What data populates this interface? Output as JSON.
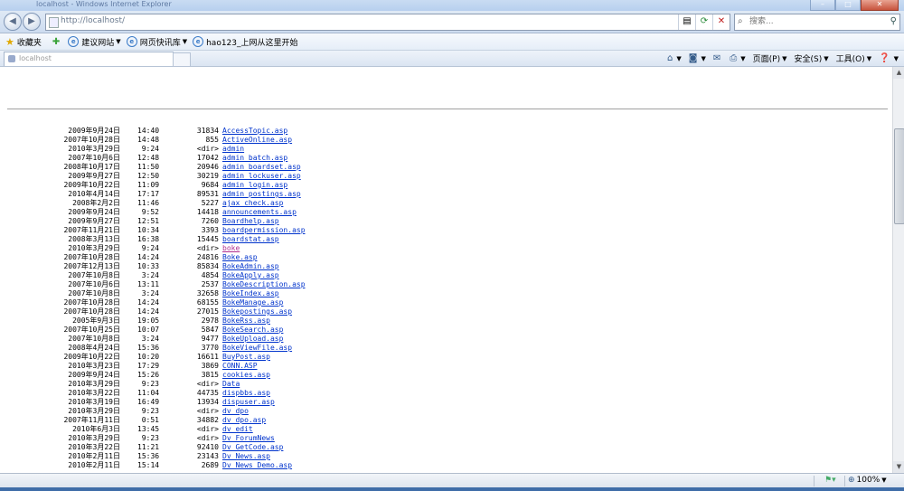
{
  "window": {
    "title": "localhost - Windows Internet Explorer",
    "controls": {
      "minimize": "–",
      "maximize": "□",
      "close": "✕"
    }
  },
  "nav": {
    "back_icon": "◀",
    "forward_icon": "▶",
    "url": "http://localhost/",
    "search_placeholder": "搜索...",
    "icons": {
      "compat": "compat-view-icon",
      "refresh": "refresh-icon",
      "stop": "stop-icon",
      "search": "search-icon"
    }
  },
  "favorites": {
    "label": "收藏夹",
    "items": [
      {
        "label": "建议网站"
      },
      {
        "label": "网页快讯库"
      },
      {
        "label": "hao123_上网从这里开始"
      }
    ]
  },
  "tab": {
    "label": "localhost"
  },
  "commands": {
    "page": "页面(P)",
    "safety": "安全(S)",
    "tools": "工具(O)"
  },
  "status": {
    "zoom": "100%"
  },
  "listing": [
    {
      "date": "2009年9月24日",
      "time": "14:40",
      "size": "31834",
      "name": "AccessTopic.asp"
    },
    {
      "date": "2007年10月28日",
      "time": "14:48",
      "size": "855",
      "name": "ActiveOnline.asp"
    },
    {
      "date": "2010年3月29日",
      "time": "9:24",
      "size": "<dir>",
      "name": "admin"
    },
    {
      "date": "2007年10月6日",
      "time": "12:48",
      "size": "17042",
      "name": "admin_batch.asp"
    },
    {
      "date": "2008年10月17日",
      "time": "11:50",
      "size": "20946",
      "name": "admin_boardset.asp"
    },
    {
      "date": "2009年9月27日",
      "time": "12:50",
      "size": "30219",
      "name": "admin_lockuser.asp"
    },
    {
      "date": "2009年10月22日",
      "time": "11:09",
      "size": "9684",
      "name": "admin_login.asp"
    },
    {
      "date": "2010年4月14日",
      "time": "17:17",
      "size": "89531",
      "name": "admin_postings.asp"
    },
    {
      "date": "2008年2月2日",
      "time": "11:46",
      "size": "5227",
      "name": "ajax_check.asp"
    },
    {
      "date": "2009年9月24日",
      "time": "9:52",
      "size": "14418",
      "name": "announcements.asp"
    },
    {
      "date": "2009年9月27日",
      "time": "12:51",
      "size": "7260",
      "name": "Boardhelp.asp"
    },
    {
      "date": "2007年11月21日",
      "time": "10:34",
      "size": "3393",
      "name": "boardpermission.asp"
    },
    {
      "date": "2008年3月13日",
      "time": "16:38",
      "size": "15445",
      "name": "boardstat.asp"
    },
    {
      "date": "2010年3月29日",
      "time": "9:24",
      "size": "<dir>",
      "name": "boke",
      "visited": true
    },
    {
      "date": "2007年10月28日",
      "time": "14:24",
      "size": "24816",
      "name": "Boke.asp"
    },
    {
      "date": "2007年12月13日",
      "time": "10:33",
      "size": "85834",
      "name": "BokeAdmin.asp"
    },
    {
      "date": "2007年10月8日",
      "time": "3:24",
      "size": "4854",
      "name": "BokeApply.asp"
    },
    {
      "date": "2007年10月6日",
      "time": "13:11",
      "size": "2537",
      "name": "BokeDescription.asp"
    },
    {
      "date": "2007年10月8日",
      "time": "3:24",
      "size": "32658",
      "name": "BokeIndex.asp"
    },
    {
      "date": "2007年10月28日",
      "time": "14:24",
      "size": "68155",
      "name": "BokeManage.asp"
    },
    {
      "date": "2007年10月28日",
      "time": "14:24",
      "size": "27015",
      "name": "Bokepostings.asp"
    },
    {
      "date": "2005年9月3日",
      "time": "19:05",
      "size": "2978",
      "name": "BokeRss.asp"
    },
    {
      "date": "2007年10月25日",
      "time": "10:07",
      "size": "5847",
      "name": "BokeSearch.asp"
    },
    {
      "date": "2007年10月8日",
      "time": "3:24",
      "size": "9477",
      "name": "BokeUpload.asp"
    },
    {
      "date": "2008年4月24日",
      "time": "15:36",
      "size": "3770",
      "name": "BokeViewFile.asp"
    },
    {
      "date": "2009年10月22日",
      "time": "10:20",
      "size": "16611",
      "name": "BuyPost.asp"
    },
    {
      "date": "2010年3月23日",
      "time": "17:29",
      "size": "3869",
      "name": "CONN.ASP"
    },
    {
      "date": "2009年9月24日",
      "time": "15:26",
      "size": "3815",
      "name": "cookies.asp"
    },
    {
      "date": "2010年3月29日",
      "time": "9:23",
      "size": "<dir>",
      "name": "Data"
    },
    {
      "date": "2010年3月22日",
      "time": "11:04",
      "size": "44735",
      "name": "dispbbs.asp"
    },
    {
      "date": "2010年3月19日",
      "time": "16:49",
      "size": "13934",
      "name": "dispuser.asp"
    },
    {
      "date": "2010年3月29日",
      "time": "9:23",
      "size": "<dir>",
      "name": "dv_dpo"
    },
    {
      "date": "2007年11月11日",
      "time": "0:51",
      "size": "34882",
      "name": "dv_dpo.asp"
    },
    {
      "date": "2010年6月3日",
      "time": "13:45",
      "size": "<dir>",
      "name": "dv_edit"
    },
    {
      "date": "2010年3月29日",
      "time": "9:23",
      "size": "<dir>",
      "name": "Dv_ForumNews"
    },
    {
      "date": "2010年3月22日",
      "time": "11:21",
      "size": "92410",
      "name": "Dv_GetCode.asp"
    },
    {
      "date": "2010年2月11日",
      "time": "15:36",
      "size": "23143",
      "name": "Dv_News.asp"
    },
    {
      "date": "2010年2月11日",
      "time": "15:14",
      "size": "2689",
      "name": "Dv_News_Demo.asp"
    }
  ]
}
